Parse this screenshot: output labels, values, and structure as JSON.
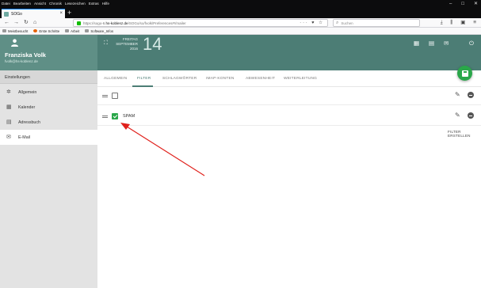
{
  "browser": {
    "menu": [
      "Datei",
      "Bearbeiten",
      "Ansicht",
      "Chronik",
      "Lesezeichen",
      "Extras",
      "Hilfe"
    ],
    "window_controls": [
      "–",
      "□",
      "✕"
    ],
    "tab_title": "SOGo",
    "tab_close": "×",
    "new_tab": "+",
    "url_prefix": "https://sogo-6.",
    "url_domain": "hs-koblenz.de",
    "url_path": "/SOGo/so/fvolk/Preferences#!/mailer",
    "url_icons": "··· ♥ ☆",
    "search_placeholder": "Suchen",
    "toolbar_icons": [
      "⤓",
      "⫼",
      "▣",
      "≡"
    ],
    "bookmarks": [
      "Meistbesucht",
      "Erste Schritte",
      "Arbeit",
      "Software_Infos"
    ]
  },
  "user": {
    "name": "Franziska Volk",
    "email": "fvolk@hs-koblenz.de"
  },
  "header": {
    "weekday": "FREITAG",
    "month": "SEPTEMBER",
    "year": "2016",
    "day": "14"
  },
  "sidebar": {
    "section": "Einstellungen",
    "items": [
      {
        "label": "Allgemein",
        "icon": "gear-icon"
      },
      {
        "label": "Kalender",
        "icon": "calendar-icon"
      },
      {
        "label": "Adressbuch",
        "icon": "contacts-icon"
      },
      {
        "label": "E-Mail",
        "icon": "mail-icon",
        "active": true
      }
    ]
  },
  "tabs": [
    "ALLGEMEIN",
    "FILTER",
    "SCHLAGWÖRTER",
    "IMAP-KONTEN",
    "ABWESENHEIT",
    "WEITERLEITUNG"
  ],
  "active_tab": "FILTER",
  "filters": [
    {
      "name": "",
      "enabled": false
    },
    {
      "name": "SPAM",
      "enabled": true
    }
  ],
  "create_filter_label": "FILTER ERSTELLEN",
  "colors": {
    "header": "#4c7d75",
    "user_card": "#5f8f86",
    "fab": "#2aa74a",
    "annotation_arrow": "#e0201b"
  }
}
